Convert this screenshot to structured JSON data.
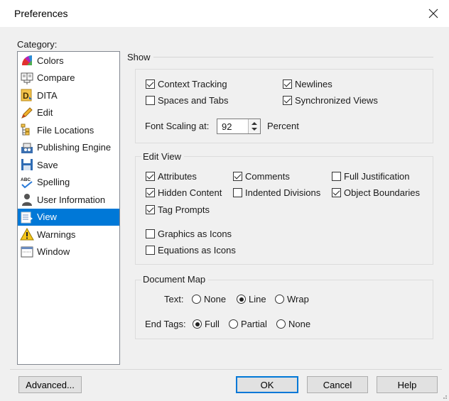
{
  "window": {
    "title": "Preferences"
  },
  "category": {
    "label": "Category:",
    "items": [
      {
        "label": "Colors",
        "icon": "colors-icon"
      },
      {
        "label": "Compare",
        "icon": "compare-icon"
      },
      {
        "label": "DITA",
        "icon": "dita-icon"
      },
      {
        "label": "Edit",
        "icon": "edit-icon"
      },
      {
        "label": "File Locations",
        "icon": "file-locations-icon"
      },
      {
        "label": "Publishing Engine",
        "icon": "publishing-engine-icon"
      },
      {
        "label": "Save",
        "icon": "save-icon"
      },
      {
        "label": "Spelling",
        "icon": "spelling-icon"
      },
      {
        "label": "User Information",
        "icon": "user-icon"
      },
      {
        "label": "View",
        "icon": "view-icon"
      },
      {
        "label": "Warnings",
        "icon": "warning-icon"
      },
      {
        "label": "Window",
        "icon": "window-icon"
      }
    ],
    "selected": "View"
  },
  "show": {
    "title": "Show",
    "context_tracking": {
      "label": "Context Tracking",
      "checked": true
    },
    "newlines": {
      "label": "Newlines",
      "checked": true
    },
    "spaces_tabs": {
      "label": "Spaces and Tabs",
      "checked": false
    },
    "synchronized_views": {
      "label": "Synchronized Views",
      "checked": true
    },
    "font_scaling_label": "Font Scaling at:",
    "font_scaling_value": "92",
    "percent_label": "Percent"
  },
  "edit_view": {
    "title": "Edit View",
    "attributes": {
      "label": "Attributes",
      "checked": true
    },
    "comments": {
      "label": "Comments",
      "checked": true
    },
    "full_justification": {
      "label": "Full Justification",
      "checked": false
    },
    "hidden_content": {
      "label": "Hidden Content",
      "checked": true
    },
    "indented_divisions": {
      "label": "Indented Divisions",
      "checked": false
    },
    "object_boundaries": {
      "label": "Object Boundaries",
      "checked": true
    },
    "tag_prompts": {
      "label": "Tag Prompts",
      "checked": true
    },
    "graphics_as_icons": {
      "label": "Graphics as Icons",
      "checked": false
    },
    "equations_as_icons": {
      "label": "Equations as Icons",
      "checked": false
    }
  },
  "document_map": {
    "title": "Document Map",
    "text_label": "Text:",
    "text_options": [
      "None",
      "Line",
      "Wrap"
    ],
    "text_selected": "Line",
    "end_tags_label": "End Tags:",
    "end_tags_options": [
      "Full",
      "Partial",
      "None"
    ],
    "end_tags_selected": "Full"
  },
  "buttons": {
    "advanced": "Advanced...",
    "ok": "OK",
    "cancel": "Cancel",
    "help": "Help"
  }
}
